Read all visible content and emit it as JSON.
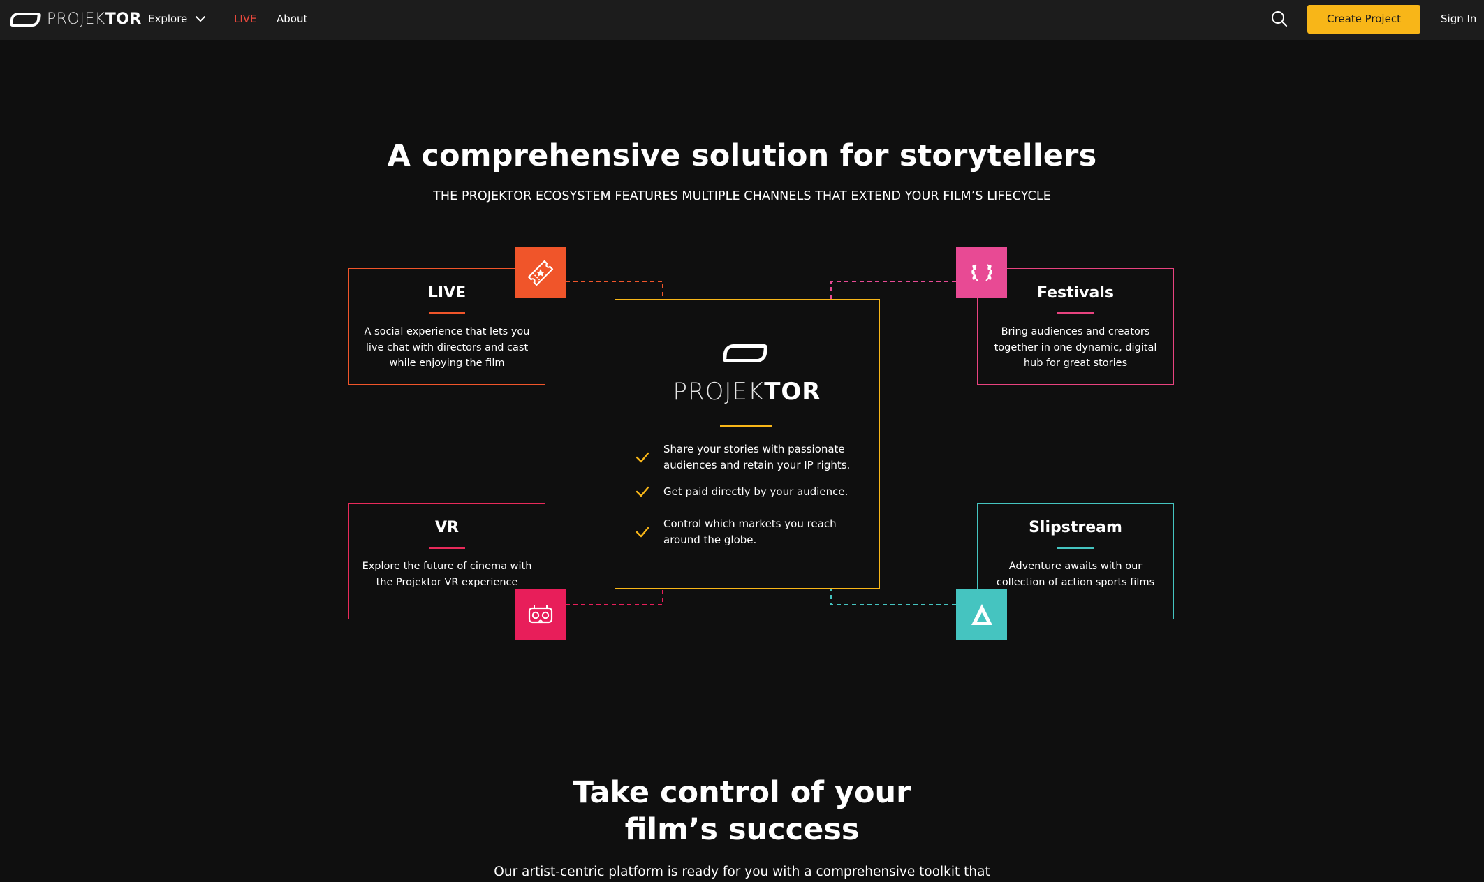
{
  "nav": {
    "brand_light": "PROJEK",
    "brand_bold": "TOR",
    "explore_label": "Explore",
    "live_label": "LIVE",
    "about_label": "About",
    "create_label": "Create Project",
    "signin_label": "Sign In",
    "live_color": "#f04a3e",
    "accent_color": "#f8b618"
  },
  "hero": {
    "title": "A comprehensive solution for storytellers",
    "subtitle": "THE PROJEKTOR ECOSYSTEM FEATURES MULTIPLE CHANNELS THAT EXTEND YOUR FILM’S LIFECYCLE"
  },
  "channels": {
    "live": {
      "title": "LIVE",
      "desc": "A social experience that lets you live chat with directors and cast while enjoying the film",
      "color": "#f0552a",
      "icon": "ticket-icon"
    },
    "festivals": {
      "title": "Festivals",
      "desc": "Bring audiences and creators together in one dynamic, digital hub for great stories",
      "color": "#e84a94",
      "icon": "laurel-icon"
    },
    "vr": {
      "title": "VR",
      "desc": "Explore the future of cinema with the Projektor VR experience",
      "color": "#e81e5a",
      "icon": "vr-headset-icon"
    },
    "slipstream": {
      "title": "Slipstream",
      "desc": "Adventure awaits with our collection of action sports films",
      "color": "#45c4c0",
      "icon": "slipstream-logo-icon"
    }
  },
  "center": {
    "word_light": "PROJEK",
    "word_bold": "TOR",
    "features": [
      "Share your stories with passionate audiences and retain your IP rights.",
      "Get paid directly by your audience.",
      "Control which markets you reach around the globe."
    ]
  },
  "section2": {
    "title": "Take control of your film’s success",
    "subtitle": "Our artist-centric platform is ready for you with a comprehensive toolkit that"
  }
}
